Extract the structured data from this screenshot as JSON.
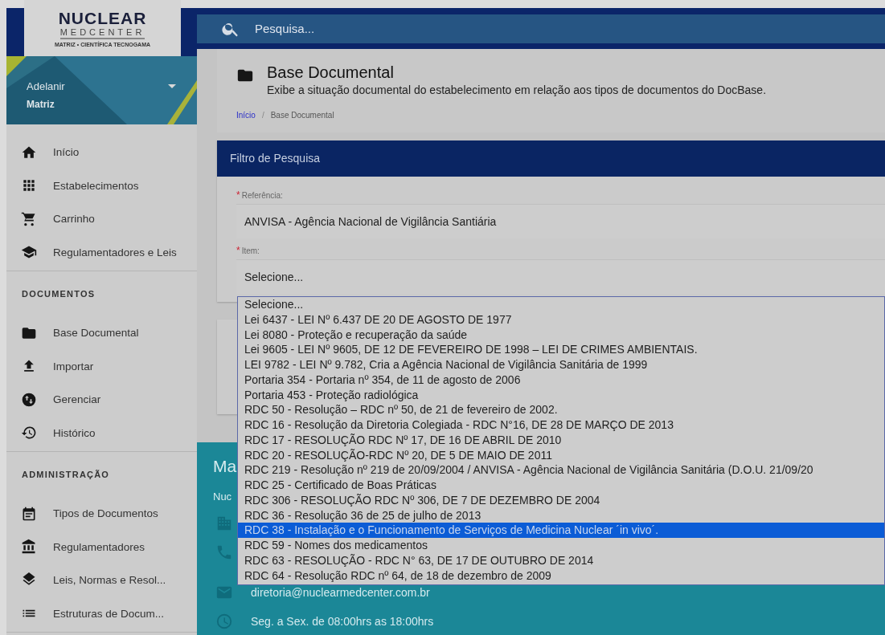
{
  "logo": {
    "title": "NUCLEAR",
    "subtitle": "MEDCENTER",
    "tagline": "MATRIZ • CIENTÍFICA TECNOGAMA"
  },
  "user": {
    "name": "Adelanir",
    "unit": "Matriz"
  },
  "search": {
    "placeholder": "Pesquisa..."
  },
  "sidebar": {
    "sections": [
      {
        "items": [
          {
            "label": "Início"
          },
          {
            "label": "Estabelecimentos"
          },
          {
            "label": "Carrinho"
          },
          {
            "label": "Regulamentadores e Leis"
          }
        ]
      },
      {
        "title": "DOCUMENTOS",
        "items": [
          {
            "label": "Base Documental"
          },
          {
            "label": "Importar"
          },
          {
            "label": "Gerenciar"
          },
          {
            "label": "Histórico"
          }
        ]
      },
      {
        "title": "ADMINISTRAÇÃO",
        "items": [
          {
            "label": "Tipos de Documentos"
          },
          {
            "label": "Regulamentadores"
          },
          {
            "label": "Leis, Normas e Resol..."
          },
          {
            "label": "Estruturas de Docum..."
          }
        ]
      }
    ]
  },
  "page": {
    "title": "Base Documental",
    "description": "Exibe a situação documental do estabelecimento em relação aos tipos de documentos do DocBase.",
    "breadcrumb_separator": "/",
    "breadcrumb": [
      {
        "label": "Início",
        "kind": "link"
      },
      {
        "label": "Base Documental",
        "kind": "current"
      }
    ]
  },
  "filter": {
    "title": "Filtro de Pesquisa",
    "fields": [
      {
        "required_mark": "*",
        "label": "Referência:",
        "value": "ANVISA - Agência Nacional de Vigilância Santiária"
      },
      {
        "required_mark": "*",
        "label": "Item:",
        "value": "Selecione..."
      }
    ]
  },
  "dropdown": {
    "options": [
      {
        "label": "Selecione...",
        "selected": false
      },
      {
        "label": "Lei 6437 - LEI Nº 6.437 DE 20 DE AGOSTO DE 1977",
        "selected": false
      },
      {
        "label": "Lei 8080 - Proteção e recuperação da saúde",
        "selected": false
      },
      {
        "label": "Lei 9605 - LEI Nº 9605, DE 12 DE FEVEREIRO DE 1998 – LEI DE CRIMES AMBIENTAIS.",
        "selected": false
      },
      {
        "label": "LEI 9782 - LEI Nº 9.782, Cria a Agência Nacional de Vigilância Sanitária de 1999",
        "selected": false
      },
      {
        "label": "Portaria 354 - Portaria nº 354, de 11 de agosto de 2006",
        "selected": false
      },
      {
        "label": "Portaria 453 - Proteção radiológica",
        "selected": false
      },
      {
        "label": "RDC 50 - Resolução – RDC nº 50, de 21 de fevereiro de 2002.",
        "selected": false
      },
      {
        "label": "RDC 16 - Resolução da Diretoria Colegiada - RDC N°16, DE 28 DE MARÇO DE 2013",
        "selected": false
      },
      {
        "label": "RDC 17 - RESOLUÇÃO RDC Nº 17, DE 16 DE ABRIL DE 2010",
        "selected": false
      },
      {
        "label": "RDC 20 - RESOLUÇÃO-RDC Nº 20, DE 5 DE MAIO DE 2011",
        "selected": false
      },
      {
        "label": "RDC 219 - Resolução nº 219 de 20/09/2004 / ANVISA - Agência Nacional de Vigilância Sanitária (D.O.U. 21/09/20",
        "selected": false
      },
      {
        "label": "RDC 25 - Certificado de Boas Práticas",
        "selected": false
      },
      {
        "label": "RDC 306 - RESOLUÇÃO RDC Nº 306, DE 7 DE DEZEMBRO DE 2004",
        "selected": false
      },
      {
        "label": "RDC 36 - Resolução 36 de 25 de julho de 2013",
        "selected": false
      },
      {
        "label": "RDC 38 - Instalação e o Funcionamento de Serviços de Medicina Nuclear ´in vivo´.",
        "selected": true
      },
      {
        "label": "RDC 59 - Nomes dos medicamentos",
        "selected": false
      },
      {
        "label": "RDC 63 - RESOLUÇÃO - RDC N° 63, DE 17 DE OUTUBRO DE 2014",
        "selected": false
      },
      {
        "label": "RDC 64 - Resolução RDC nº 64, de 18 de dezembro de 2009",
        "selected": false
      }
    ]
  },
  "footer": {
    "title": "Ma",
    "subtitle": "Nuc",
    "email": "diretoria@nuclearmedcenter.com.br",
    "hours": "Seg. a Sex. de 08:00hrs as 18:00hrs"
  }
}
